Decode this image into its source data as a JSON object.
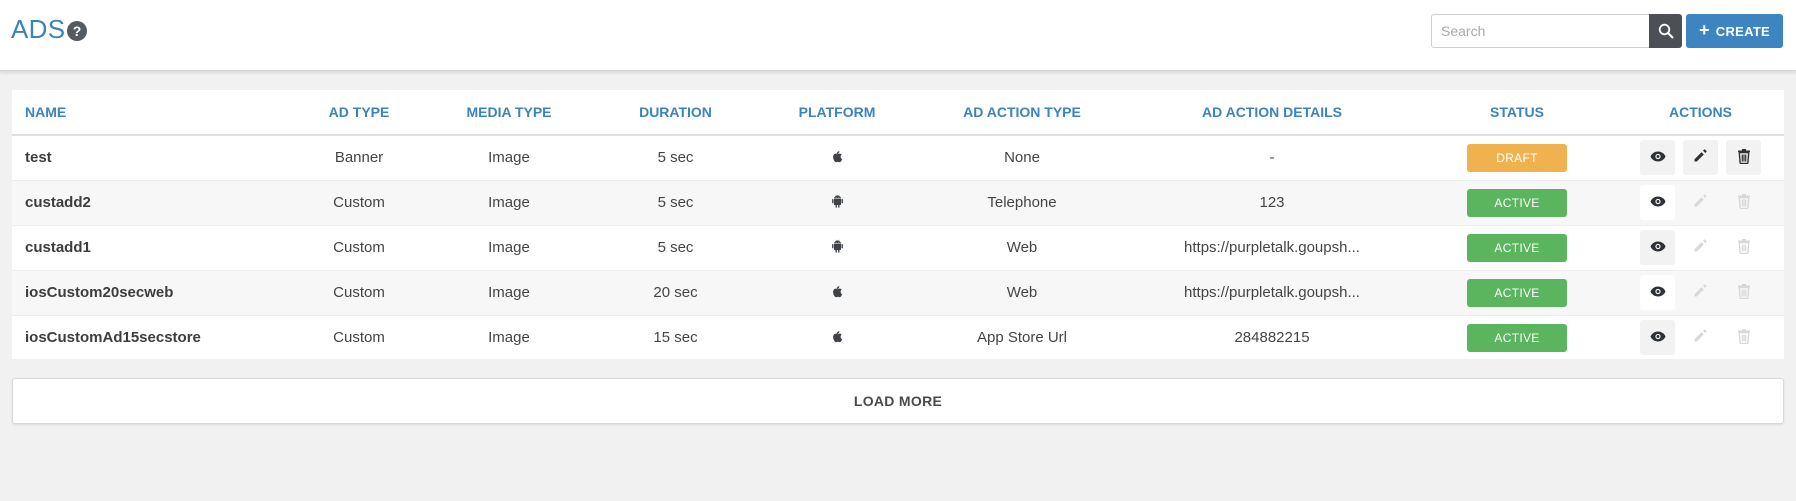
{
  "header": {
    "title": "ADS",
    "help_label": "?",
    "search_placeholder": "Search",
    "create_label": "CREATE",
    "create_icon": "plus-icon"
  },
  "colors": {
    "accent": "#3b83bd",
    "draft": "#efb24f",
    "active": "#5bb55e",
    "dark_button": "#4c5056"
  },
  "table": {
    "columns": [
      "NAME",
      "AD TYPE",
      "MEDIA TYPE",
      "DURATION",
      "PLATFORM",
      "AD ACTION TYPE",
      "AD ACTION DETAILS",
      "STATUS",
      "ACTIONS"
    ],
    "rows": [
      {
        "name": "test",
        "ad_type": "Banner",
        "media_type": "Image",
        "duration": "5 sec",
        "platform": "apple-icon",
        "action_type": "None",
        "action_details": "-",
        "status": "DRAFT",
        "edit_enabled": true
      },
      {
        "name": "custadd2",
        "ad_type": "Custom",
        "media_type": "Image",
        "duration": "5 sec",
        "platform": "android-icon",
        "action_type": "Telephone",
        "action_details": "123",
        "status": "ACTIVE",
        "edit_enabled": false
      },
      {
        "name": "custadd1",
        "ad_type": "Custom",
        "media_type": "Image",
        "duration": "5 sec",
        "platform": "android-icon",
        "action_type": "Web",
        "action_details": "https://purpletalk.goupsh...",
        "status": "ACTIVE",
        "edit_enabled": false
      },
      {
        "name": "iosCustom20secweb",
        "ad_type": "Custom",
        "media_type": "Image",
        "duration": "20 sec",
        "platform": "apple-icon",
        "action_type": "Web",
        "action_details": "https://purpletalk.goupsh...",
        "status": "ACTIVE",
        "edit_enabled": false
      },
      {
        "name": "iosCustomAd15secstore",
        "ad_type": "Custom",
        "media_type": "Image",
        "duration": "15 sec",
        "platform": "apple-icon",
        "action_type": "App Store Url",
        "action_details": "284882215",
        "status": "ACTIVE",
        "edit_enabled": false
      }
    ]
  },
  "footer": {
    "load_more_label": "LOAD MORE"
  }
}
